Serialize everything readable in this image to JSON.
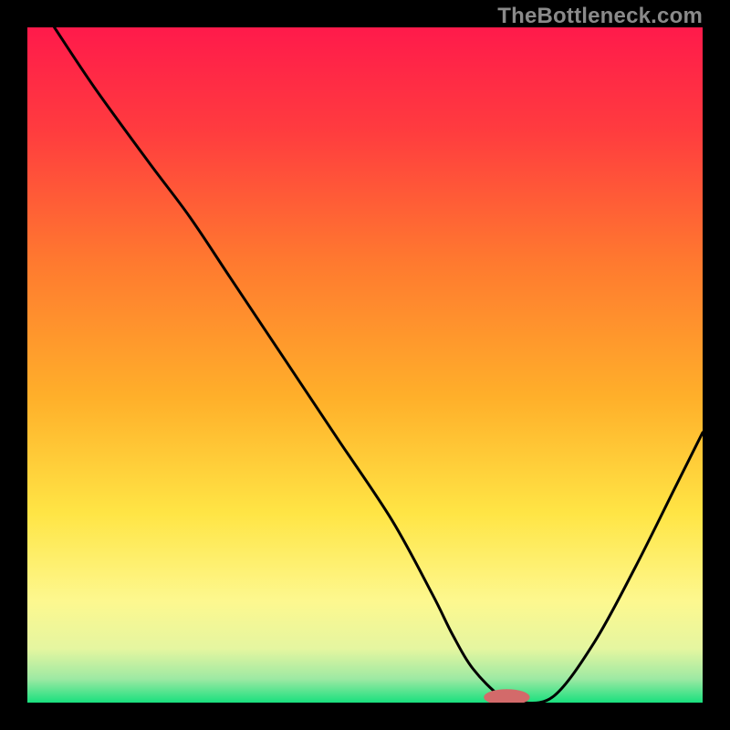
{
  "watermark": "TheBottleneck.com",
  "chart_data": {
    "type": "line",
    "title": "",
    "xlabel": "",
    "ylabel": "",
    "xlim": [
      0,
      100
    ],
    "ylim": [
      0,
      100
    ],
    "grid": false,
    "legend": false,
    "gradient_stops": [
      {
        "offset": 0.0,
        "color": "#ff1a4b"
      },
      {
        "offset": 0.15,
        "color": "#ff3b3f"
      },
      {
        "offset": 0.35,
        "color": "#ff7a2f"
      },
      {
        "offset": 0.55,
        "color": "#ffb02a"
      },
      {
        "offset": 0.72,
        "color": "#ffe545"
      },
      {
        "offset": 0.85,
        "color": "#fdf88f"
      },
      {
        "offset": 0.92,
        "color": "#e5f6a0"
      },
      {
        "offset": 0.965,
        "color": "#9de9a3"
      },
      {
        "offset": 1.0,
        "color": "#19e07e"
      }
    ],
    "series": [
      {
        "name": "bottleneck-curve",
        "color": "#000000",
        "width": 3,
        "x": [
          4,
          10,
          18,
          24,
          30,
          38,
          46,
          54,
          60,
          63,
          66,
          70,
          73,
          78,
          84,
          90,
          96,
          100
        ],
        "y": [
          100,
          91,
          80,
          72,
          63,
          51,
          39,
          27,
          16,
          10,
          5,
          1,
          0,
          1,
          9,
          20,
          32,
          40
        ]
      }
    ],
    "marker": {
      "name": "optimal-point-marker",
      "cx": 71,
      "cy": 0.8,
      "rx": 3.4,
      "ry": 1.2,
      "fill": "#d36a6a"
    }
  }
}
